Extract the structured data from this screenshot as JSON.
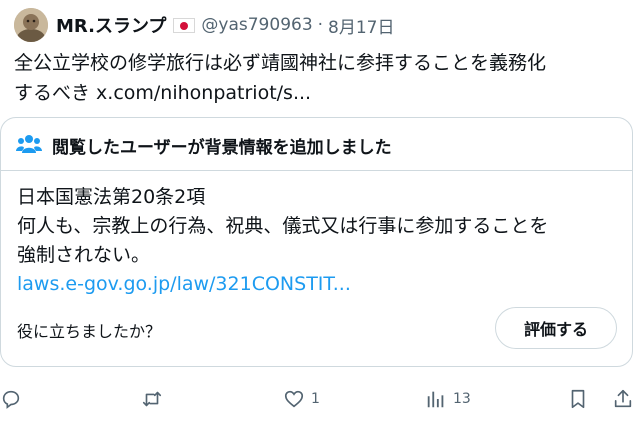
{
  "tweet": {
    "author_name": "MR.スランプ",
    "handle": "@yas790963",
    "separator": "·",
    "date": "8月17日",
    "text_line1": "全公立学校の修学旅行は必ず靖國神社に参拝することを義務化",
    "text_line2_prefix": "するべき ",
    "link": "x.com/nihonpatriot/s..."
  },
  "community_note": {
    "title": "閲覧したユーザーが背景情報を追加しました",
    "line1": "日本国憲法第20条2項",
    "line2": "何人も、宗教上の行為、祝典、儀式又は行事に参加することを",
    "line3": "強制されない。",
    "link": "laws.e-gov.go.jp/law/321CONSTIT...",
    "helpful_question": "役に立ちましたか？",
    "rate_button": "評価する"
  },
  "actions": {
    "reply_icon": "reply-icon",
    "retweet_icon": "retweet-icon",
    "like_icon": "heart-icon",
    "like_count": "1",
    "views_icon": "views-icon",
    "views_count": "13",
    "bookmark_icon": "bookmark-icon",
    "share_icon": "share-icon"
  },
  "colors": {
    "link_blue": "#1d9bf0",
    "text_secondary": "#536471",
    "border": "#cfd9de",
    "flag_red": "#d3103a"
  }
}
